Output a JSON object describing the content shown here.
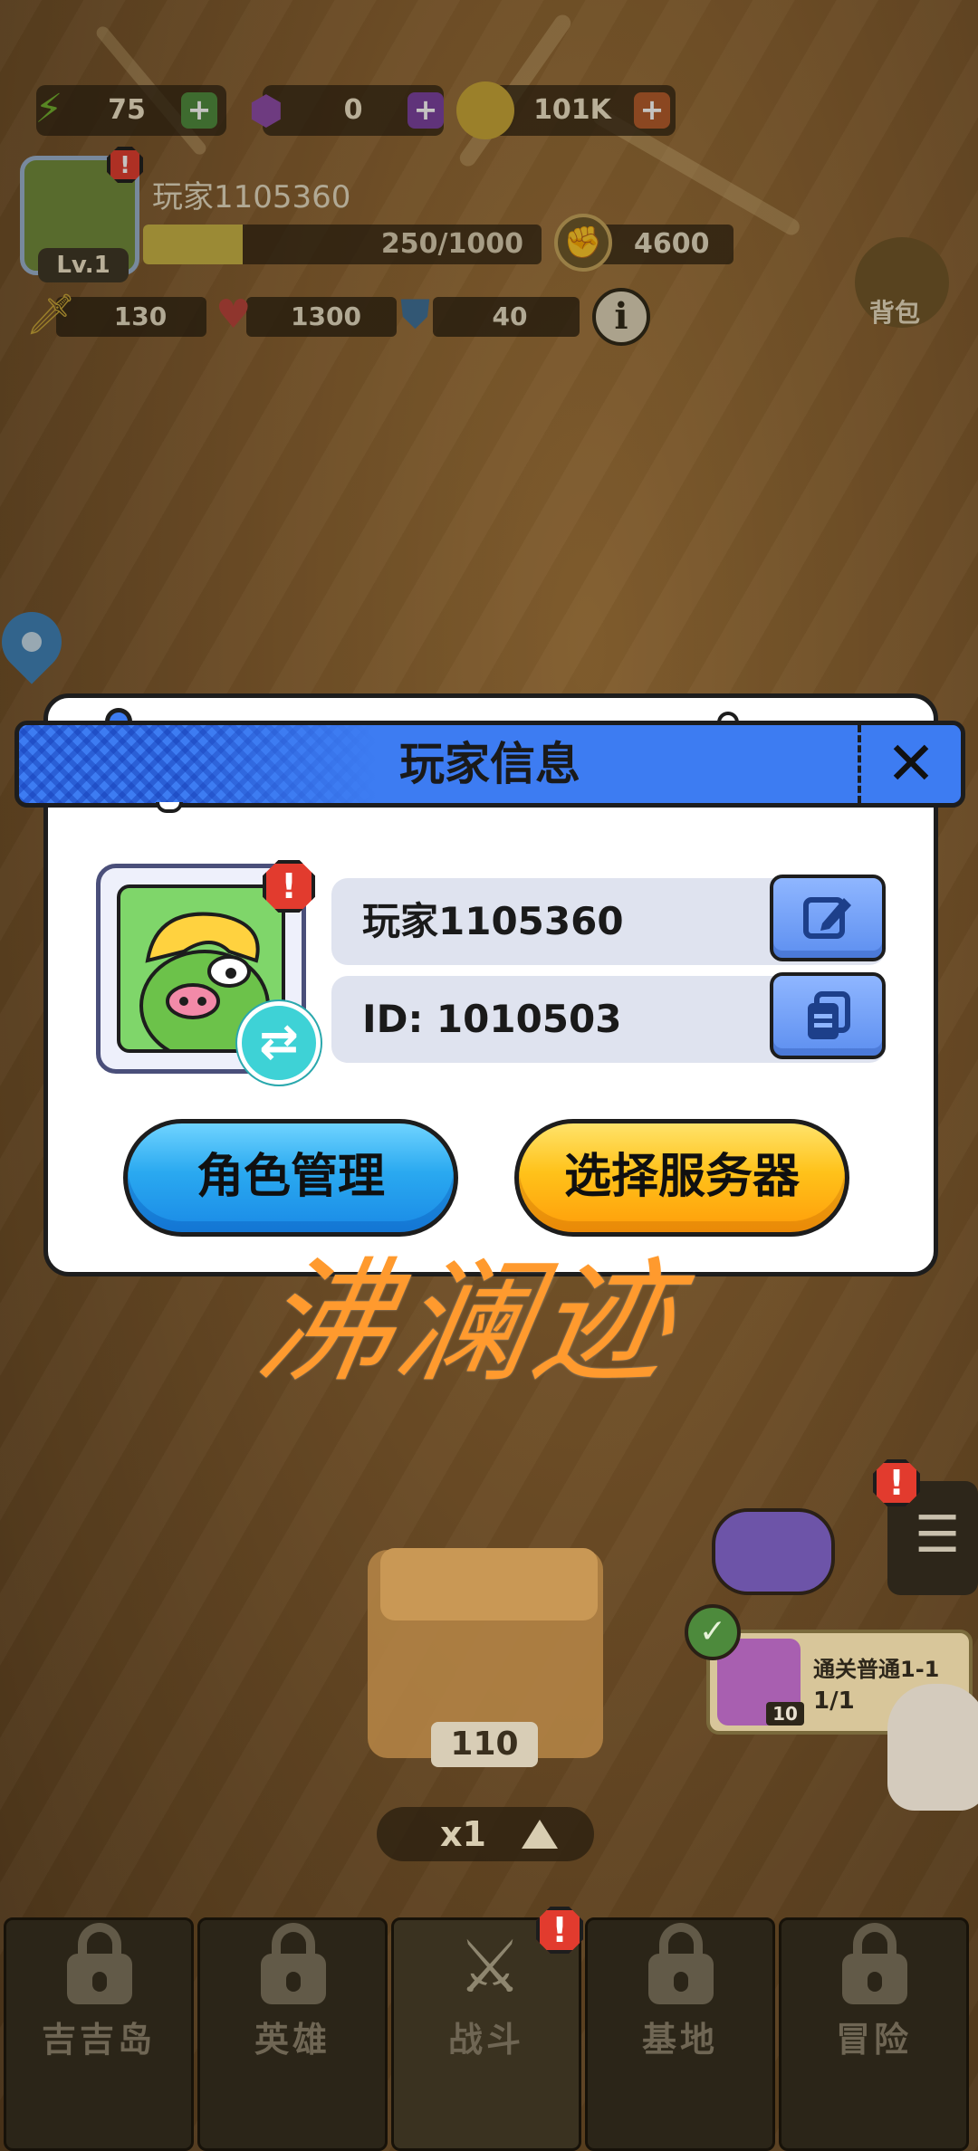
{
  "hud": {
    "energy": "75",
    "gems": "0",
    "coins": "101K",
    "player_name": "玩家1105360",
    "level": "Lv.1",
    "xp_text": "250/1000",
    "xp_fraction": 0.25,
    "power": "4600",
    "attack": "130",
    "hp": "1300",
    "defense": "40",
    "bag_label": "背包"
  },
  "modal": {
    "title": "玩家信息",
    "name_value": "玩家1105360",
    "id_value": "ID: 1010503",
    "alert_mark": "!",
    "role_manage_label": "角色管理",
    "select_server_label": "选择服务器"
  },
  "watermark": "沸澜迹",
  "bottom": {
    "box_count": "110",
    "speed": "x1",
    "quest_title": "通关普通1-1",
    "quest_progress": "1/1",
    "quest_reward_count": "10"
  },
  "tabs": [
    {
      "label": "吉吉岛"
    },
    {
      "label": "英雄"
    },
    {
      "label": "战斗"
    },
    {
      "label": "基地"
    },
    {
      "label": "冒险"
    }
  ],
  "colors": {
    "modal_header": "#3d7cf2",
    "blue_button": "#2aa9f0",
    "yellow_button": "#ffc21a",
    "watermark": "#ff9a2e"
  }
}
